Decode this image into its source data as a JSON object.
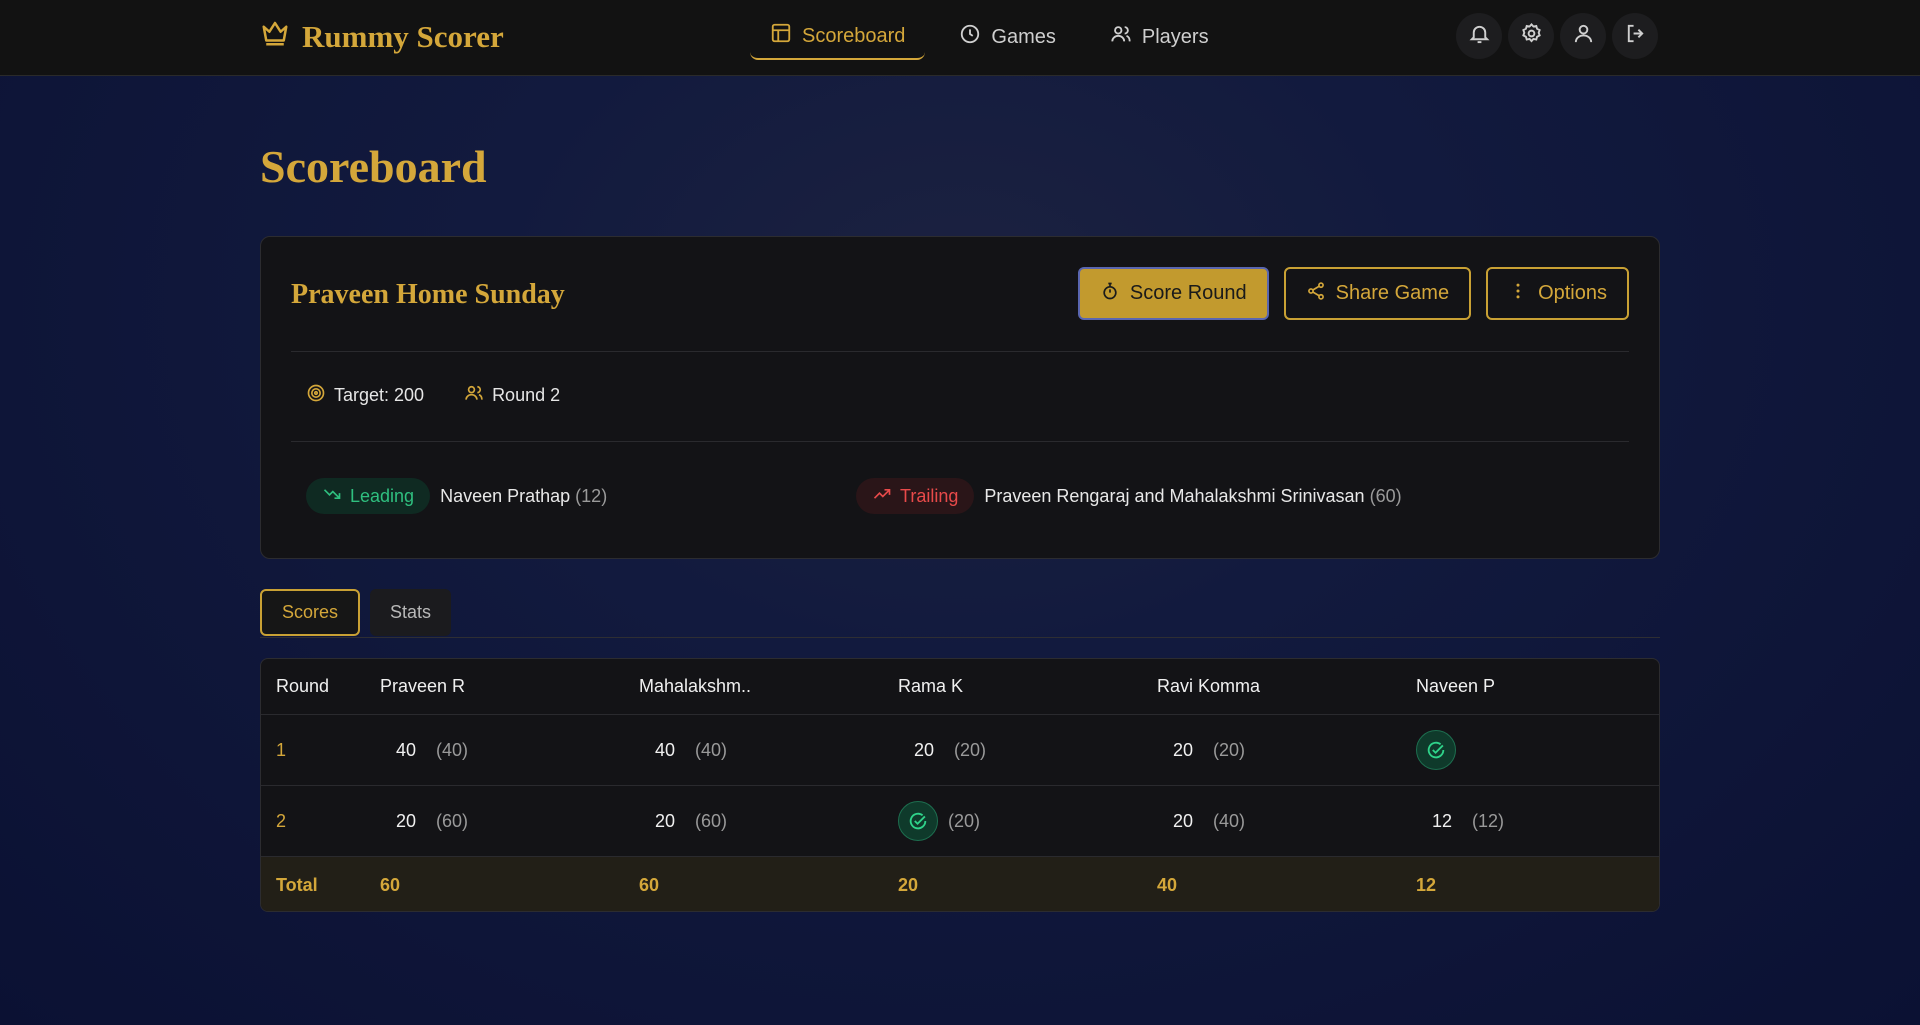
{
  "app": {
    "brand": "Rummy Scorer"
  },
  "nav": [
    {
      "label": "Scoreboard",
      "icon": "layout-icon",
      "active": true
    },
    {
      "label": "Games",
      "icon": "clock-icon"
    },
    {
      "label": "Players",
      "icon": "users-icon"
    }
  ],
  "header_icons": [
    "bell-icon",
    "gear-icon",
    "user-icon",
    "logout-icon"
  ],
  "page": {
    "title": "Scoreboard"
  },
  "game": {
    "name": "Praveen Home Sunday",
    "actions": {
      "score_round": "Score Round",
      "share_game": "Share Game",
      "options": "Options"
    },
    "target": "Target: 200",
    "round": "Round 2",
    "leading": {
      "label": "Leading",
      "names": "Naveen Prathap",
      "score": "(12)"
    },
    "trailing": {
      "label": "Trailing",
      "names": "Praveen Rengaraj and Mahalakshmi Srinivasan",
      "score": "(60)"
    }
  },
  "tabs": [
    {
      "label": "Scores",
      "active": true
    },
    {
      "label": "Stats"
    }
  ],
  "table": {
    "headers": [
      "Round",
      "Praveen R",
      "Mahalakshm..",
      "Rama K",
      "Ravi Komma",
      "Naveen P"
    ],
    "rounds": [
      {
        "round": "1",
        "cells": [
          {
            "score": "40",
            "cum": "(40)"
          },
          {
            "score": "40",
            "cum": "(40)"
          },
          {
            "score": "20",
            "cum": "(20)"
          },
          {
            "score": "20",
            "cum": "(20)"
          },
          {
            "winner": true,
            "cum": ""
          }
        ]
      },
      {
        "round": "2",
        "cells": [
          {
            "score": "20",
            "cum": "(60)"
          },
          {
            "score": "20",
            "cum": "(60)"
          },
          {
            "winner": true,
            "cum": "(20)"
          },
          {
            "score": "20",
            "cum": "(40)"
          },
          {
            "score": "12",
            "cum": "(12)"
          }
        ]
      }
    ],
    "total_label": "Total",
    "totals": [
      "60",
      "60",
      "20",
      "40",
      "12"
    ]
  },
  "colors": {
    "accent": "#d4a73a",
    "lead": "#2fbf7f",
    "trail": "#e84a4a",
    "background": "#0b1133"
  }
}
